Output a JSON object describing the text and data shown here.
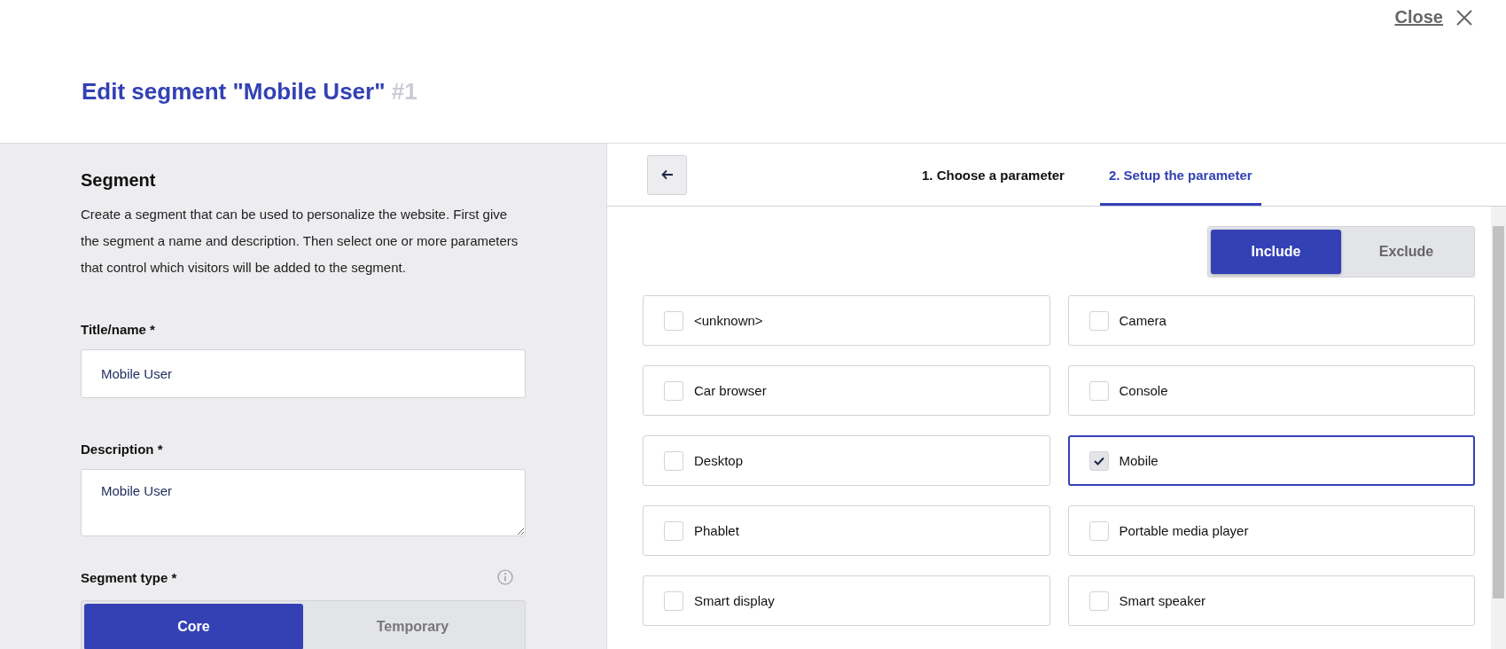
{
  "header": {
    "close_label": "Close",
    "title": "Edit segment \"Mobile User\"",
    "title_id": "#1"
  },
  "segment_panel": {
    "heading": "Segment",
    "description": "Create a segment that can be used to personalize the website. First give the segment a name and description. Then select one or more parameters that control which visitors will be added to the segment.",
    "title_field": {
      "label": "Title/name *",
      "value": "Mobile User"
    },
    "description_field": {
      "label": "Description *",
      "value": "Mobile User"
    },
    "segment_type": {
      "label": "Segment type *",
      "options": [
        {
          "label": "Core",
          "selected": true
        },
        {
          "label": "Temporary",
          "selected": false
        }
      ]
    }
  },
  "parameter_panel": {
    "steps": [
      {
        "label": "1. Choose a parameter",
        "selected": false
      },
      {
        "label": "2. Setup the parameter",
        "selected": true
      }
    ],
    "mode": [
      {
        "label": "Include",
        "selected": true
      },
      {
        "label": "Exclude",
        "selected": false
      }
    ],
    "options": [
      {
        "label": "<unknown>",
        "checked": false
      },
      {
        "label": "Camera",
        "checked": false
      },
      {
        "label": "Car browser",
        "checked": false
      },
      {
        "label": "Console",
        "checked": false
      },
      {
        "label": "Desktop",
        "checked": false
      },
      {
        "label": "Mobile",
        "checked": true
      },
      {
        "label": "Phablet",
        "checked": false
      },
      {
        "label": "Portable media player",
        "checked": false
      },
      {
        "label": "Smart display",
        "checked": false
      },
      {
        "label": "Smart speaker",
        "checked": false
      }
    ]
  }
}
